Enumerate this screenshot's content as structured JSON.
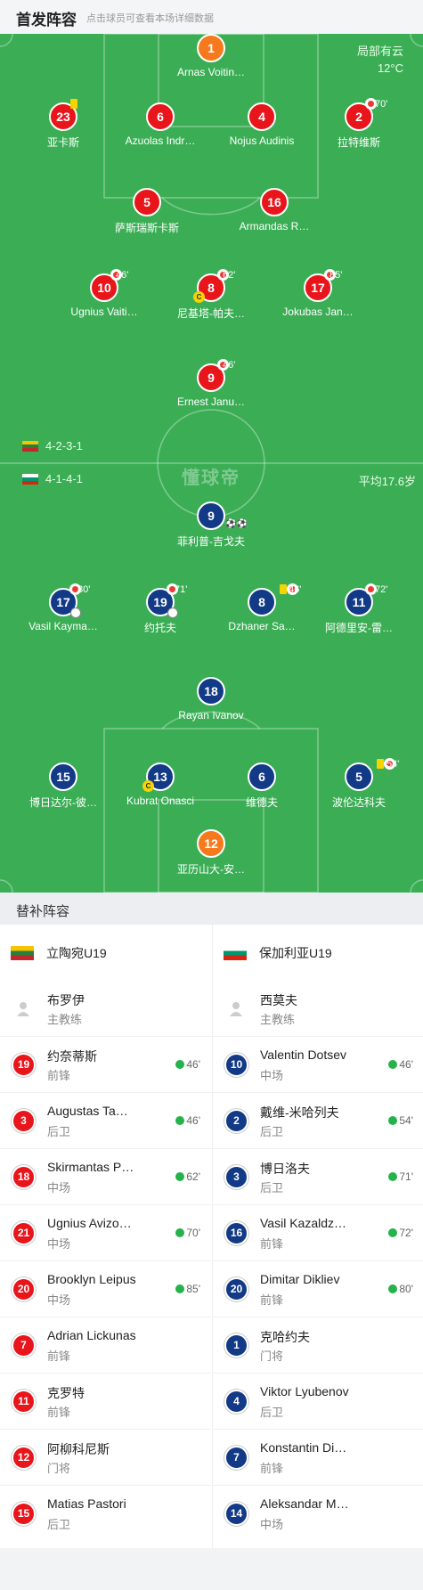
{
  "header": {
    "title": "首发阵容",
    "subtitle": "点击球员可查看本场详细数据"
  },
  "weather": {
    "condition": "局部有云",
    "temp": "12°C"
  },
  "home": {
    "formation": "4-2-3-1",
    "players": [
      {
        "num": "1",
        "name": "Arnas Voitin…",
        "kit": "orange"
      },
      {
        "num": "23",
        "name": "亚卡斯",
        "kit": "red",
        "yellow": true
      },
      {
        "num": "6",
        "name": "Azuolas Indr…",
        "kit": "red"
      },
      {
        "num": "4",
        "name": "Nojus Audinis",
        "kit": "red"
      },
      {
        "num": "2",
        "name": "拉特维斯",
        "kit": "red",
        "sub_min": "70'"
      },
      {
        "num": "5",
        "name": "萨斯瑞斯卡斯",
        "kit": "red"
      },
      {
        "num": "16",
        "name": "Armandas R…",
        "kit": "red"
      },
      {
        "num": "10",
        "name": "Ugnius Vaiti…",
        "kit": "red",
        "sub_min": "46'"
      },
      {
        "num": "8",
        "name": "尼基塔-帕夫…",
        "kit": "red",
        "sub_min": "62'",
        "captain": "C"
      },
      {
        "num": "17",
        "name": "Jokubas Jan…",
        "kit": "red",
        "sub_min": "85'"
      },
      {
        "num": "9",
        "name": "Ernest Janu…",
        "kit": "red",
        "sub_min": "46'"
      }
    ]
  },
  "away": {
    "formation": "4-1-4-1",
    "avg_age": "平均17.6岁",
    "players": [
      {
        "num": "9",
        "name": "菲利普-吉戈夫",
        "kit": "blue",
        "goals": "⚽⚽"
      },
      {
        "num": "17",
        "name": "Vasil Kayma…",
        "kit": "blue",
        "sub_min": "80'"
      },
      {
        "num": "19",
        "name": "约托夫",
        "kit": "blue",
        "sub_min": "71'"
      },
      {
        "num": "8",
        "name": "Dzhaner Sa…",
        "kit": "blue",
        "sub_min": "46'",
        "yellow": true
      },
      {
        "num": "11",
        "name": "阿德里安-雷…",
        "kit": "blue",
        "sub_min": "72'"
      },
      {
        "num": "18",
        "name": "Rayan Ivanov",
        "kit": "blue"
      },
      {
        "num": "15",
        "name": "博日达尔-彼…",
        "kit": "blue"
      },
      {
        "num": "13",
        "name": "Kubrat Onasci",
        "kit": "blue",
        "captain": "C"
      },
      {
        "num": "6",
        "name": "维德夫",
        "kit": "blue"
      },
      {
        "num": "5",
        "name": "波伦达科夫",
        "kit": "blue",
        "sub_min": "54'",
        "yellow": true
      },
      {
        "num": "12",
        "name": "亚历山大-安…",
        "kit": "orange"
      }
    ]
  },
  "pitch_logo": "懂球帝",
  "subs": {
    "title": "替补阵容",
    "home_team": "立陶宛U19",
    "away_team": "保加利亚U19",
    "home_coach": {
      "name": "布罗伊",
      "role": "主教练"
    },
    "away_coach": {
      "name": "西莫夫",
      "role": "主教练"
    },
    "home": [
      {
        "num": "19",
        "name": "约奈蒂斯",
        "pos": "前锋",
        "in": "46'"
      },
      {
        "num": "3",
        "name": "Augustas Ta…",
        "pos": "后卫",
        "in": "46'"
      },
      {
        "num": "18",
        "name": "Skirmantas P…",
        "pos": "中场",
        "in": "62'"
      },
      {
        "num": "21",
        "name": "Ugnius Avizo…",
        "pos": "中场",
        "in": "70'"
      },
      {
        "num": "20",
        "name": "Brooklyn Leipus",
        "pos": "中场",
        "in": "85'"
      },
      {
        "num": "7",
        "name": "Adrian Lickunas",
        "pos": "前锋",
        "in": ""
      },
      {
        "num": "11",
        "name": "克罗特",
        "pos": "前锋",
        "in": ""
      },
      {
        "num": "12",
        "name": "阿柳科尼斯",
        "pos": "门将",
        "in": ""
      },
      {
        "num": "15",
        "name": "Matias Pastori",
        "pos": "后卫",
        "in": ""
      }
    ],
    "away": [
      {
        "num": "10",
        "name": "Valentin Dotsev",
        "pos": "中场",
        "in": "46'"
      },
      {
        "num": "2",
        "name": "戴维-米哈列夫",
        "pos": "后卫",
        "in": "54'"
      },
      {
        "num": "3",
        "name": "博日洛夫",
        "pos": "后卫",
        "in": "71'"
      },
      {
        "num": "16",
        "name": "Vasil Kazaldz…",
        "pos": "前锋",
        "in": "72'"
      },
      {
        "num": "20",
        "name": "Dimitar Dikliev",
        "pos": "前锋",
        "in": "80'"
      },
      {
        "num": "1",
        "name": "克哈约夫",
        "pos": "门将",
        "in": ""
      },
      {
        "num": "4",
        "name": "Viktor Lyubenov",
        "pos": "后卫",
        "in": ""
      },
      {
        "num": "7",
        "name": "Konstantin Di…",
        "pos": "前锋",
        "in": ""
      },
      {
        "num": "14",
        "name": "Aleksandar M…",
        "pos": "中场",
        "in": ""
      }
    ]
  }
}
